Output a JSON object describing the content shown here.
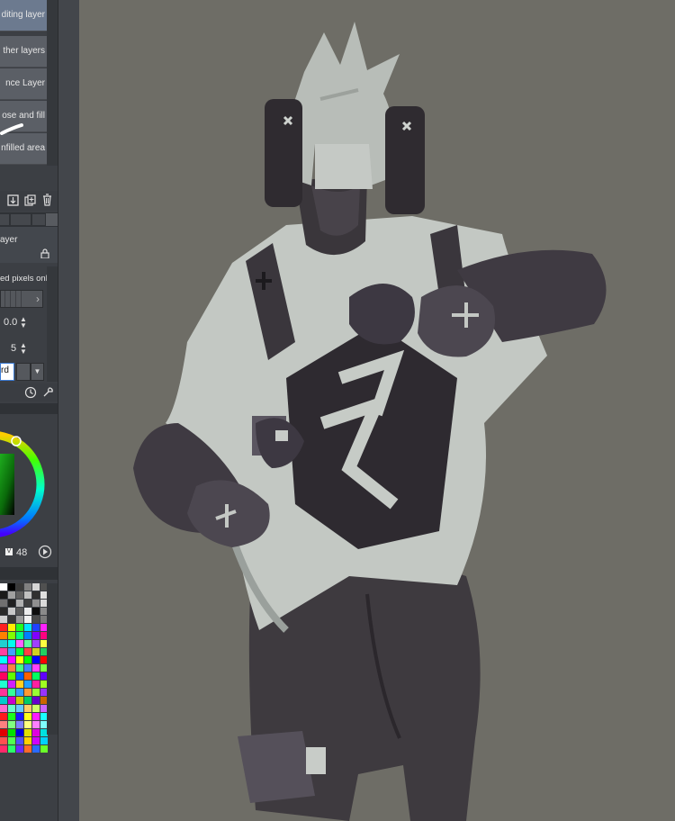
{
  "tool_options": {
    "items": [
      {
        "label": "diting layer",
        "selected": true
      },
      {
        "label": "ther layers",
        "selected": false
      },
      {
        "label": "nce Layer",
        "selected": false
      },
      {
        "label": "ose and fill",
        "selected": false
      },
      {
        "label": "nfilled area",
        "selected": false
      }
    ]
  },
  "layer_toolbar": {
    "icons": [
      "import-icon",
      "copy-icon",
      "trash-icon"
    ]
  },
  "layer_props": {
    "title": "ayer",
    "ref_label": "ed pixels only",
    "value_a": "0.0",
    "value_b": "5",
    "combo_value": "rd"
  },
  "color_panel": {
    "hsv_label": "V",
    "hsv_value": "48",
    "colors": {
      "hue_ring": "#00ff66",
      "selected": "#118a11"
    }
  },
  "palette": {
    "colors": [
      "#ffffff",
      "#000000",
      "#3a3a3a",
      "#808080",
      "#d6d6d6",
      "#505050",
      "#1a1a1a",
      "#a0a0a0",
      "#606060",
      "#c0c0c0",
      "#303030",
      "#e0e0e0",
      "#707070",
      "#202020",
      "#b0b0b0",
      "#404040",
      "#909090",
      "#dadada",
      "#2a2a2a",
      "#c8c8c8",
      "#5a5a5a",
      "#ececec",
      "#0e0e0e",
      "#8a8a8a",
      "#d0d0d0",
      "#383838",
      "#9a9a9a",
      "#f0f0f0",
      "#4a4a4a",
      "#7a7a7a",
      "#ff2020",
      "#ffee00",
      "#20ff20",
      "#00e5ff",
      "#2040ff",
      "#ff20ff",
      "#ff8000",
      "#80ff00",
      "#00ff80",
      "#0080ff",
      "#8000ff",
      "#ff0080",
      "#20d0d0",
      "#00ffee",
      "#ff60ff",
      "#60ffa0",
      "#a040ff",
      "#ffff40",
      "#ff40a0",
      "#40a0ff",
      "#00ff40",
      "#ff4040",
      "#d0d020",
      "#20d060",
      "#00ffff",
      "#ff00ff",
      "#ffff00",
      "#00ff00",
      "#0000ff",
      "#ff0000",
      "#c040ff",
      "#ff8040",
      "#40ff80",
      "#4080ff",
      "#ff40ff",
      "#80ff40",
      "#ff0060",
      "#60ff00",
      "#0060ff",
      "#ff6000",
      "#00ff60",
      "#6000ff",
      "#20ffd0",
      "#d020ff",
      "#ffd020",
      "#20a0ff",
      "#ff20a0",
      "#a0ff20",
      "#ff3399",
      "#33ff99",
      "#3399ff",
      "#ff9933",
      "#99ff33",
      "#9933ff",
      "#00cccc",
      "#cc00cc",
      "#cccc00",
      "#00cc66",
      "#6600cc",
      "#cc6600",
      "#ff66cc",
      "#66ffcc",
      "#66ccff",
      "#ffcc66",
      "#ccff66",
      "#cc66ff",
      "#ff1a1a",
      "#1aff1a",
      "#1a1aff",
      "#ffff1a",
      "#ff1aff",
      "#1affff",
      "#ff8080",
      "#80ff80",
      "#8080ff",
      "#ffff80",
      "#ff80ff",
      "#80ffff",
      "#e00000",
      "#00e000",
      "#0000e0",
      "#e0e000",
      "#e000e0",
      "#00e0e0",
      "#ff5050",
      "#50ff50",
      "#5050ff",
      "#ffd000",
      "#d000ff",
      "#00d0ff",
      "#ff2a6a",
      "#2aff6a",
      "#6a2aff",
      "#ff6a2a",
      "#2a6aff",
      "#6aff2a"
    ]
  },
  "canvas": {
    "background": "#6e6d66",
    "artwork": "grayscale-character-illustration"
  }
}
